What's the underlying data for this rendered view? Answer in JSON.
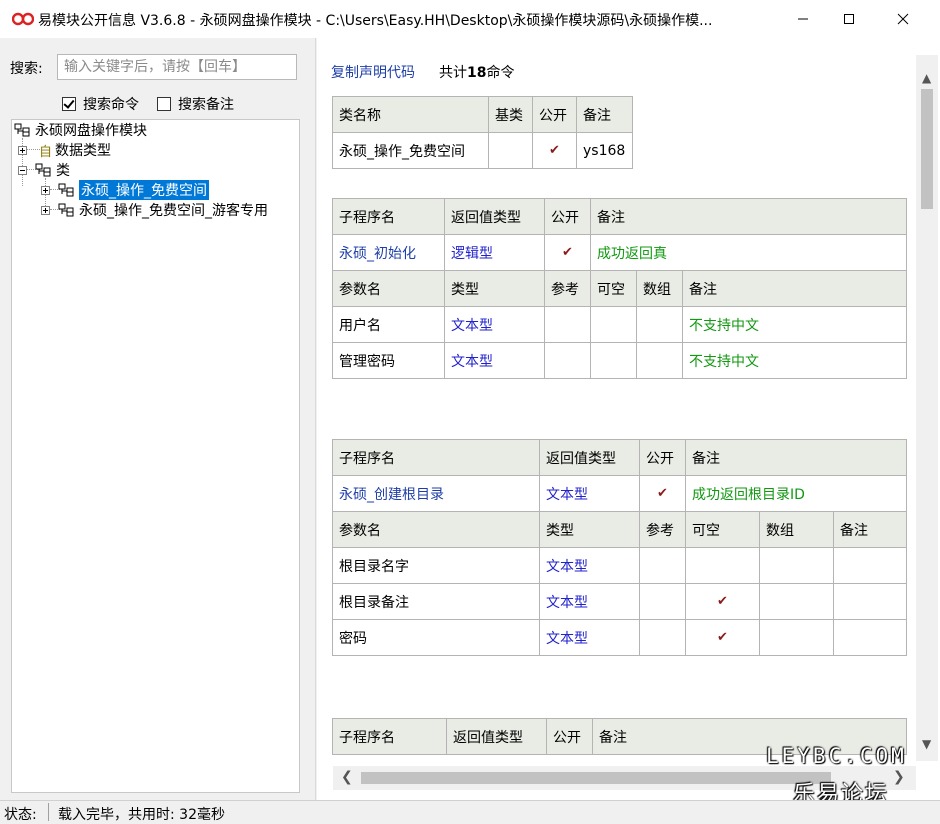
{
  "window": {
    "title": "易模块公开信息 V3.6.8 - 永硕网盘操作模块 - C:\\Users\\Easy.HH\\Desktop\\永硕操作模块源码\\永硕操作模..."
  },
  "search": {
    "label": "搜索:",
    "placeholder": "输入关键字后，请按【回车】",
    "search_commands_label": "搜索命令",
    "search_commands_checked": true,
    "search_notes_label": "搜索备注",
    "search_notes_checked": false
  },
  "tree": {
    "root": "永硕网盘操作模块",
    "data_types": "数据类型",
    "classes": "类",
    "class1": "永硕_操作_免费空间",
    "class2": "永硕_操作_免费空间_游客专用"
  },
  "content": {
    "copy_link": "复制声明代码",
    "count_prefix": "共计",
    "count_number": "18",
    "count_suffix": "命令"
  },
  "class_table": {
    "headers": [
      "类名称",
      "基类",
      "公开",
      "备注"
    ],
    "row": {
      "name": "永硕_操作_免费空间",
      "base": "",
      "note": "ys168"
    }
  },
  "sub1": {
    "headers": [
      "子程序名",
      "返回值类型",
      "公开",
      "备注"
    ],
    "name": "永硕_初始化",
    "return_type": "逻辑型",
    "note": "成功返回真",
    "param_headers": [
      "参数名",
      "类型",
      "参考",
      "可空",
      "数组",
      "备注"
    ],
    "params": [
      {
        "name": "用户名",
        "type": "文本型",
        "note": "不支持中文"
      },
      {
        "name": "管理密码",
        "type": "文本型",
        "note": "不支持中文"
      }
    ]
  },
  "sub2": {
    "headers": [
      "子程序名",
      "返回值类型",
      "公开",
      "备注"
    ],
    "name": "永硕_创建根目录",
    "return_type": "文本型",
    "note": "成功返回根目录ID",
    "param_headers": [
      "参数名",
      "类型",
      "参考",
      "可空",
      "数组",
      "备注"
    ],
    "params": [
      {
        "name": "根目录名字",
        "type": "文本型"
      },
      {
        "name": "根目录备注",
        "type": "文本型"
      },
      {
        "name": "密码",
        "type": "文本型"
      }
    ]
  },
  "sub3": {
    "headers": [
      "子程序名",
      "返回值类型",
      "公开",
      "备注"
    ]
  },
  "watermark": {
    "en": "LEYBC.COM",
    "cn": "乐易论坛"
  },
  "status": {
    "label": "状态:",
    "text": "载入完毕，共用时: 32毫秒"
  }
}
